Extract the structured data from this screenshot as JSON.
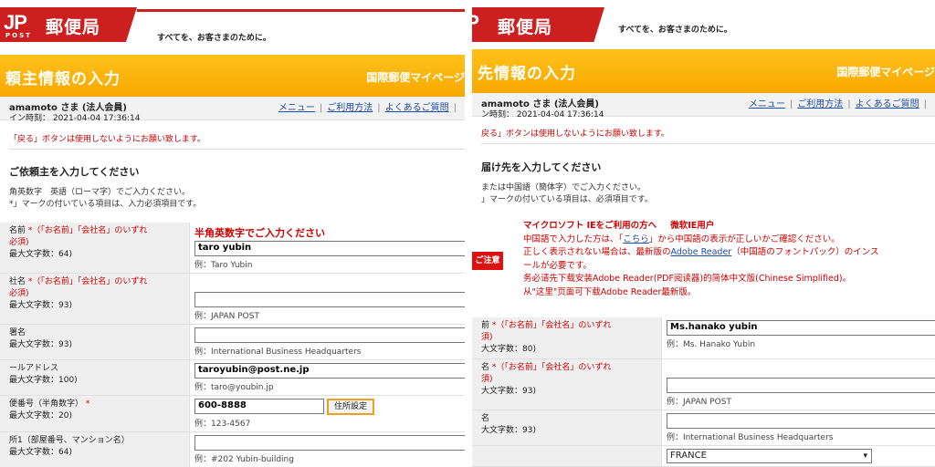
{
  "left": {
    "brand": {
      "logo_text": "JP",
      "logo_sub": "POST",
      "name": "郵便局",
      "slogan": "すべてを、お客さまのために。"
    },
    "title": "頼主情報の入力",
    "service": "国際郵便マイページ",
    "user": {
      "name": "amamoto さま (法人会員)",
      "login": "イン時刻： 2021-04-04 17:36:14"
    },
    "links": [
      "メニュー",
      "ご利用方法",
      "よくあるご質問"
    ],
    "warning": "「戻る」ボタンは使用しないようにお願い致します。",
    "section": "ご依頼主を入力してください",
    "notes": [
      "角英数字　英語（ローマ字）でご入力ください。",
      "*」マークの付いている項目は、入力必須項目です。"
    ],
    "fields": [
      {
        "label": "名前",
        "req": "*（「お名前」「会社名」のいずれ",
        "req2": "必須)",
        "max": "最大文字数：64)",
        "hint": "半角英数字でご入力ください",
        "value": "taro yubin",
        "example": "例：Taro Yubin"
      },
      {
        "label": "社名",
        "req": "*（「お名前」「会社名」のいずれ",
        "req2": "必須)",
        "max": "最大文字数：93)",
        "value": "",
        "example": "例：JAPAN POST"
      },
      {
        "label": "署名",
        "max": "最大文字数：93)",
        "value": "",
        "example": "例：International Business Headquarters"
      },
      {
        "label": "ールアドレス",
        "max": "最大文字数：100)",
        "value": "taroyubin@post.ne.jp",
        "example": "例：taro@youbin.jp"
      },
      {
        "label": "便番号（半角数字）",
        "req": "*",
        "max": "最大文字数：20)",
        "value": "600-8888",
        "button": "住所設定",
        "example": "例：123-4567"
      },
      {
        "label": "所1（部屋番号、マンション名）",
        "max": "最大文字数：64)",
        "value": "",
        "example": "例：#202 Yubin-building"
      }
    ]
  },
  "right": {
    "brand": {
      "logo_text": "JP",
      "name": "郵便局",
      "slogan": "すべてを、お客さまのために。"
    },
    "title": "先情報の入力",
    "service": "国際郵便マイページ",
    "user": {
      "name": "amamoto さま (法人会員)",
      "login": "ン時刻： 2021-04-04 17:36:14"
    },
    "links": [
      "メニュー",
      "ご利用方法",
      "よくあるご質問"
    ],
    "warning": "戻る」ボタンは使用しないようにお願い致します。",
    "section": "届け先を入力してください",
    "notes": [
      "または中国語（簡体字）でご入力ください。",
      "」マークの付いている項目は、必須項目です。"
    ],
    "caution": {
      "badge": "ご注意",
      "line1": "マイクロソフト IEをご利用の方へ",
      "line1b": "微软IE用户",
      "line2a": "中国語で入力した方は、「",
      "line2link": "こちら",
      "line2b": "」から中国語の表示が正しいかご確認ください。",
      "line3a": "正しく表示されない場合は、最新版の",
      "line3link": "Adobe Reader",
      "line3b": "（中国語のフォントパック）のインス",
      "line4": "ールが必要です。",
      "line5": "务必请先下载安装Adobe Reader(PDF阅读器)的简体中文版(Chinese Simplified)。",
      "line6": "从\"这里\"页面可下载Adobe Reader最新版。"
    },
    "fields": [
      {
        "label": "前",
        "req": "*（「お名前」「会社名」のいずれ",
        "req2": "須)",
        "max": "大文字数：80)",
        "value": "Ms.hanako yubin",
        "example": "例：Ms. Hanako Yubin"
      },
      {
        "label": "名",
        "req": "*（「お名前」「会社名」のいずれ",
        "req2": "須)",
        "max": "大文字数：93)",
        "value": "",
        "example": "例：JAPAN POST"
      },
      {
        "label": "名",
        "max": "大文字数：93)",
        "value": "",
        "example": "例：International Business Headquarters"
      }
    ],
    "country": "FRANCE"
  },
  "colors": {
    "brand_red": "#cc1f1f",
    "title_orange": "#f7a800",
    "link_blue": "#1a4ea8",
    "warning_red": "#c00000"
  }
}
